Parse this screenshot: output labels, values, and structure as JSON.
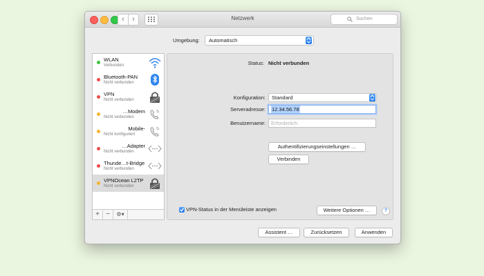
{
  "window": {
    "title": "Netzwerk",
    "search_placeholder": "Suchen",
    "nav_back": "‹",
    "nav_forward": "›"
  },
  "location": {
    "label": "Umgebung:",
    "value": "Automatisch"
  },
  "sidebar": {
    "items": [
      {
        "name": "WLAN",
        "status": "Verbunden",
        "status_color": "#3dc43f",
        "icon": "wifi-icon"
      },
      {
        "name": "Bluetooth-PAN",
        "status": "Nicht verbunden",
        "status_color": "#ef4b48",
        "icon": "bluetooth-icon"
      },
      {
        "name": "VPN",
        "status": "Nicht verbunden",
        "status_color": "#ef4b48",
        "icon": "vpn-lock-icon"
      },
      {
        "name": "…Modem",
        "status": "Nicht verbunden",
        "status_color": "#f5b42c",
        "icon": "phone-icon"
      },
      {
        "name": "Mobile-",
        "status": "Nicht konfiguriert",
        "status_color": "#f5b42c",
        "icon": "phone-icon"
      },
      {
        "name": "…Adapter",
        "status": "Nicht verbunden",
        "status_color": "#ef4b48",
        "icon": "ethernet-icon"
      },
      {
        "name": "Thunde…t-Bridge",
        "status": "Nicht verbunden",
        "status_color": "#ef4b48",
        "icon": "ethernet-icon"
      },
      {
        "name": "VPNOcean L2TP",
        "status": "Nicht verbunden",
        "status_color": "#f5b42c",
        "icon": "vpn-lock-icon"
      }
    ],
    "add_label": "+",
    "remove_label": "−",
    "action_label": "⚙▾"
  },
  "detail": {
    "status_label": "Status:",
    "status_value": "Nicht verbunden",
    "config_label": "Konfiguration:",
    "config_value": "Standard",
    "server_label": "Serveradresse:",
    "server_value": "12.34.56.78",
    "user_label": "Benutzername:",
    "user_placeholder": "Erforderlich",
    "auth_button": "Authentifizierungseinstellungen …",
    "connect_button": "Verbinden",
    "vpn_status_checkbox_label": "VPN-Status in der Menüleiste anzeigen",
    "vpn_status_checked": true,
    "more_options_button": "Weitere Optionen …",
    "help_label": "?"
  },
  "footer": {
    "assistant_button": "Assistent …",
    "revert_button": "Zurücksetzen",
    "apply_button": "Anwenden"
  },
  "colors": {
    "accent_blue": "#1b74ec",
    "status_green": "#3dc43f",
    "status_red": "#ef4b48",
    "status_yellow": "#f5b42c",
    "background": "#ebf6e0"
  }
}
